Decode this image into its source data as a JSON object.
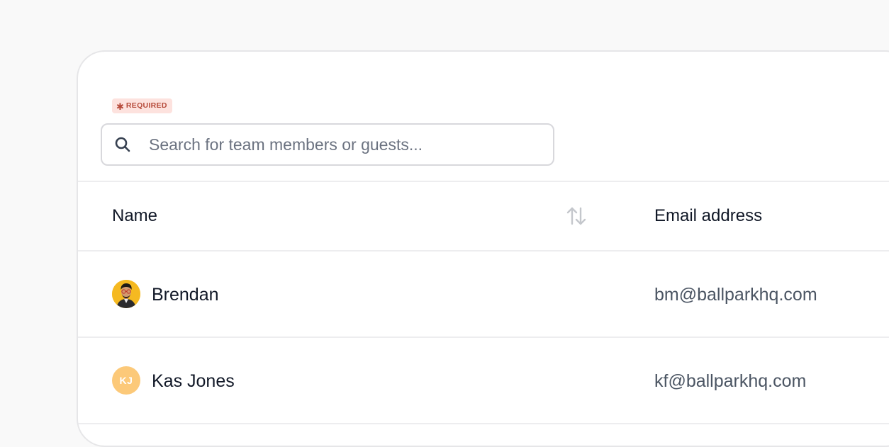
{
  "form": {
    "required_badge": "REQUIRED",
    "search": {
      "placeholder": "Search for team members or guests...",
      "value": ""
    }
  },
  "table": {
    "columns": [
      {
        "label": "Name",
        "sortable": true
      },
      {
        "label": "Email address",
        "sortable": false
      }
    ],
    "rows": [
      {
        "name": "Brendan",
        "email": "bm@ballparkhq.com",
        "avatar": "photo-avatar-icon"
      },
      {
        "name": "Kas Jones",
        "email": "kf@ballparkhq.com",
        "avatar_initials": "KJ",
        "avatar_color": "#fcc979"
      }
    ]
  },
  "icons": {
    "search": "search-icon",
    "sort": "sort-arrows-icon"
  },
  "colors": {
    "required_bg": "#fde2de",
    "required_text": "#b64a3a",
    "initials_avatar": "#fcc979"
  }
}
